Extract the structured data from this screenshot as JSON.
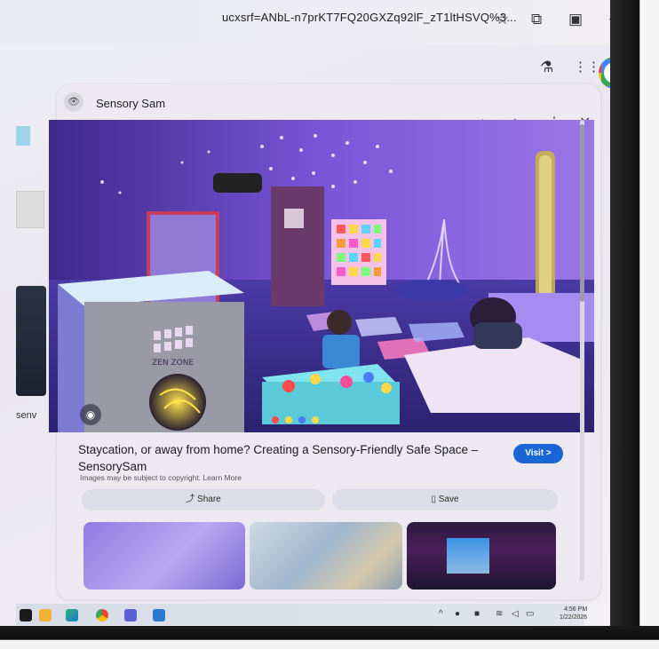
{
  "browser": {
    "url": "ucxsrf=ANbL-n7prKT7FQ20GXZq92lF_zT1ltHSVQ%3...",
    "menu_icon": "more-vert-icon"
  },
  "panel": {
    "source_name": "Sensory Sam",
    "image_title": "Staycation, or away from home? Creating a Sensory-Friendly Safe Space – SensorySam",
    "visit_label": "Visit >",
    "copyright_text": "Images may be subject to copyright.",
    "learn_more": "Learn More",
    "share_label": "Share",
    "save_label": "Save",
    "sign_text": "ZEN ZONE"
  },
  "results": {
    "partial_label": "senv"
  },
  "taskbar": {
    "time": "4:56 PM",
    "date": "1/22/2026"
  },
  "colors": {
    "accent": "#1a66d6",
    "room_purple": "#6e4fd1"
  }
}
